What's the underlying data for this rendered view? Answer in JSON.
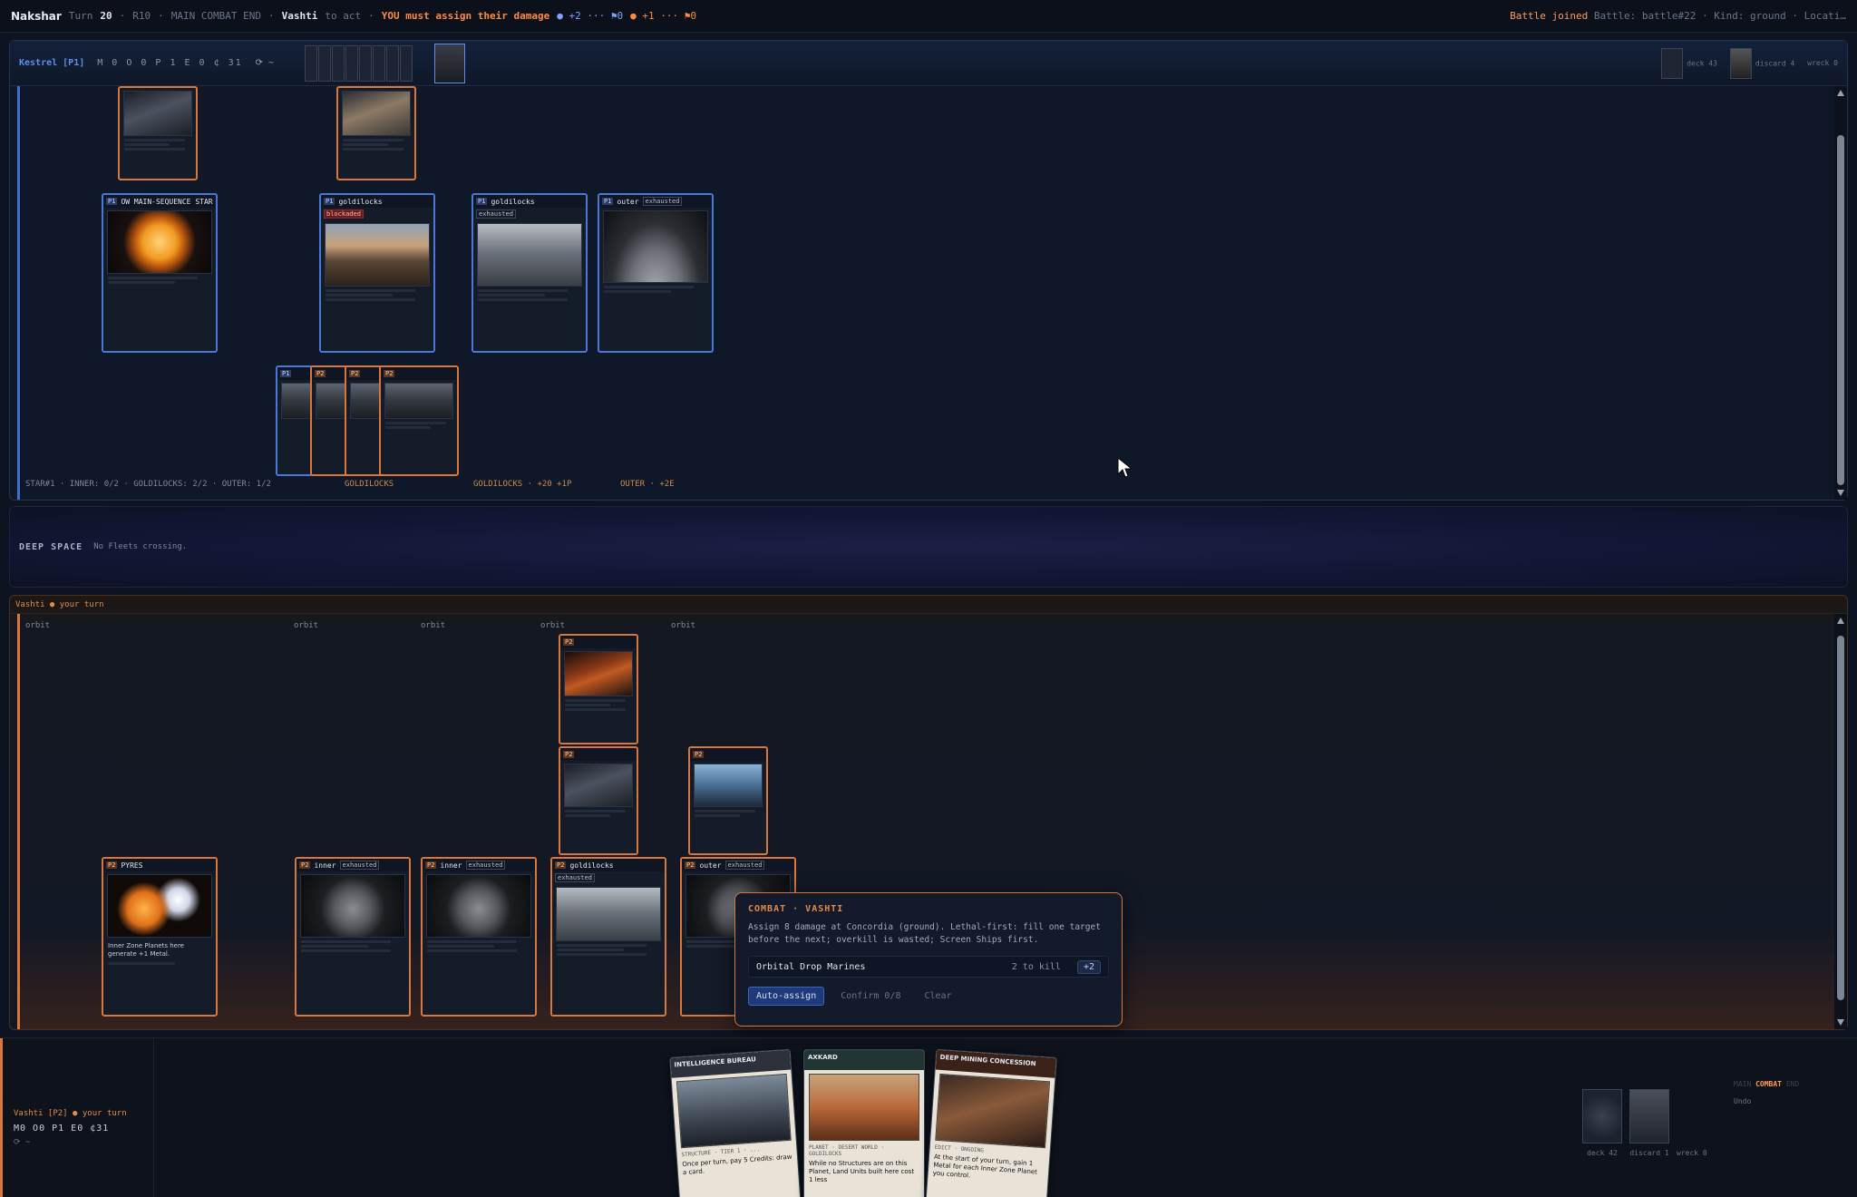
{
  "topbar": {
    "app": "Nakshar",
    "turn_label": "Turn",
    "turn": "20",
    "round": "R10",
    "phases": "MAIN COMBAT END",
    "actor": "Vashti",
    "actor_suffix": "to act",
    "alert": "YOU must assign their damage",
    "score_p1": "● +2 ··· ⚑0",
    "score_p2": "● +1 ··· ⚑0",
    "battle_prefix": "Battle joined",
    "battle_info": "Battle: battle#22 · Kind: ground · Locati…"
  },
  "opponent": {
    "name": "Kestrel [P1]",
    "stats": "M 0 O 0 P 1 E 0 ¢ 31",
    "misc": "⟳ ~",
    "deck": "deck 43",
    "discard": "discard 4",
    "wreck": "wreck 0",
    "cards": [
      {
        "tag": "P1",
        "title": "",
        "status": ""
      },
      {
        "tag": "P1",
        "title": "",
        "status": ""
      },
      {
        "tag": "P1",
        "title": "OW MAIN-SEQUENCE STAR",
        "status": ""
      },
      {
        "tag": "P1",
        "title": "goldilocks",
        "status": "blockaded"
      },
      {
        "tag": "P1",
        "title": "goldilocks",
        "status": "exhausted"
      },
      {
        "tag": "P1",
        "title": "outer",
        "status": "exhausted"
      },
      {
        "tag": "P1",
        "title": "",
        "status": ""
      },
      {
        "tag": "P2",
        "title": "",
        "status": ""
      },
      {
        "tag": "P2",
        "title": "",
        "status": ""
      },
      {
        "tag": "P2",
        "title": "",
        "status": ""
      }
    ],
    "labels": {
      "summary": "STAR#1 · INNER: 0/2 · GOLDILOCKS: 2/2 · OUTER: 1/2",
      "goldilocks": "GOLDILOCKS",
      "goldilocks2": "GOLDILOCKS · +20 +1P",
      "outer": "OUTER · +2E"
    }
  },
  "deep_space": {
    "title": "DEEP SPACE",
    "text": "No Fleets crossing."
  },
  "me": {
    "header": "Vashti ● your turn",
    "orbit_label": "orbit",
    "cards": [
      {
        "tag": "P2",
        "title": "",
        "status": ""
      },
      {
        "tag": "P2",
        "title": "",
        "status": ""
      },
      {
        "tag": "P2",
        "title": "",
        "status": ""
      },
      {
        "tag": "P2",
        "title": "PYRES",
        "status": "",
        "text": "Inner Zone Planets here generate +1 Metal."
      },
      {
        "tag": "P2",
        "title": "inner",
        "status": "exhausted"
      },
      {
        "tag": "P2",
        "title": "inner",
        "status": "exhausted"
      },
      {
        "tag": "P2",
        "title": "goldilocks",
        "status": "exhausted"
      },
      {
        "tag": "P2",
        "title": "outer",
        "status": "exhausted"
      }
    ]
  },
  "combat": {
    "title": "COMBAT · VASHTI",
    "desc": "Assign 8 damage at Concordia (ground). Lethal-first: fill one target before the next; overkill is wasted; Screen Ships first.",
    "target_name": "Orbital Drop Marines",
    "target_kill": "2 to kill",
    "target_amount": "+2",
    "auto": "Auto-assign",
    "confirm": "Confirm 0/8",
    "clear": "Clear"
  },
  "bottom": {
    "player": "Vashti [P2] ● your turn",
    "stats": "M0 O0 P1 E0 ¢31",
    "misc": "⟳ ~",
    "hand": [
      {
        "title": "INTELLIGENCE BUREAU",
        "type": "STRUCTURE · TIER 1 · ...",
        "text": "Once per turn, pay 5 Credits: draw a card."
      },
      {
        "title": "AXKARD",
        "type": "PLANET · DESERT WORLD · GOLDILOCKS",
        "text": "While no Structures are on this Planet, Land Units built here cost 1 less"
      },
      {
        "title": "DEEP MINING CONCESSION",
        "type": "EDICT · ONGOING",
        "text": "At the start of your turn, gain 1 Metal for each Inner Zone Planet you control."
      }
    ],
    "deck": "deck 42",
    "discard": "discard 1",
    "wreck": "wreck 0",
    "phase_main": "MAIN",
    "phase_combat": "COMBAT",
    "phase_end": "END",
    "undo": "Undo"
  },
  "colors": {
    "p1": "#4a78d8",
    "p2": "#d9763a",
    "alert": "#ff8a3d"
  }
}
